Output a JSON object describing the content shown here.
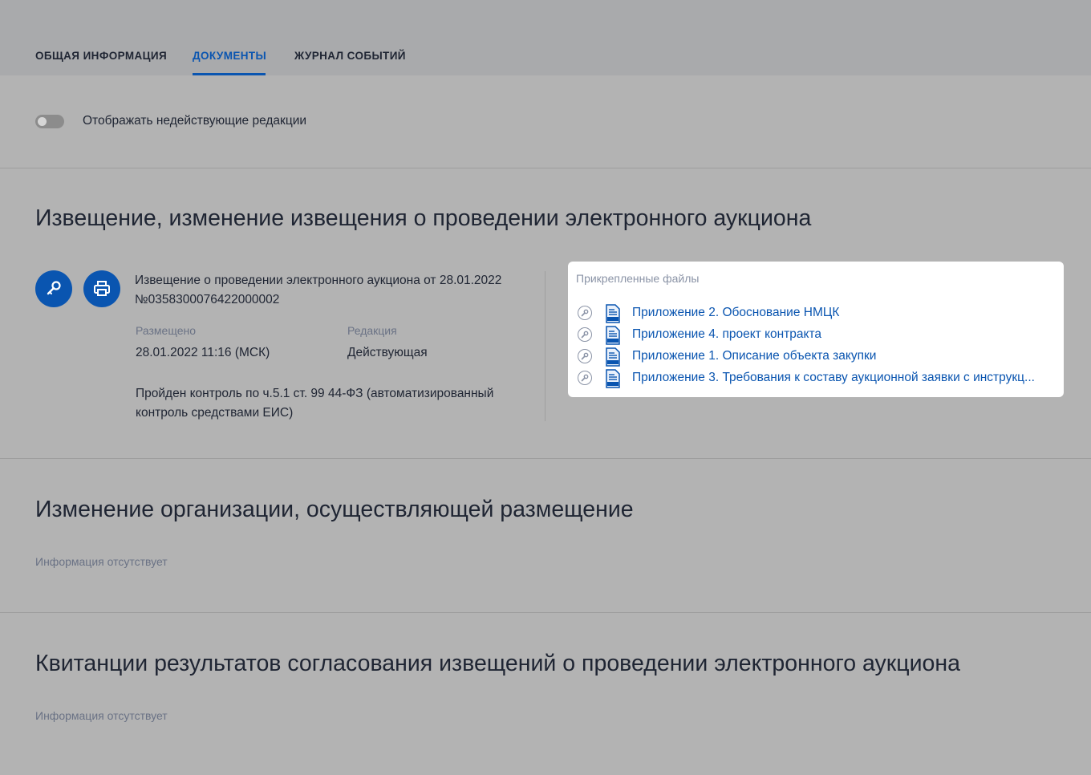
{
  "tabs": [
    {
      "label": "ОБЩАЯ ИНФОРМАЦИЯ",
      "active": false
    },
    {
      "label": "ДОКУМЕНТЫ",
      "active": true
    },
    {
      "label": "ЖУРНАЛ СОБЫТИЙ",
      "active": false
    }
  ],
  "toggle": {
    "label": "Отображать недействующие редакции",
    "checked": false
  },
  "sections": {
    "notice": {
      "title": "Извещение, изменение извещения о проведении электронного аукциона",
      "document_title": "Извещение о проведении электронного аукциона от 28.01.2022 №0358300076422000002",
      "placed_label": "Размещено",
      "placed_value": "28.01.2022 11:16 (МСК)",
      "edition_label": "Редакция",
      "edition_value": "Действующая",
      "control_text": "Пройден контроль по ч.5.1 ст. 99 44-ФЗ (автоматизированный контроль средствами ЕИС)",
      "attached_header": "Прикрепленные файлы",
      "files": [
        {
          "name": "Приложение 2. Обоснование НМЦК"
        },
        {
          "name": "Приложение 4. проект контракта"
        },
        {
          "name": "Приложение 1. Описание объекта закупки"
        },
        {
          "name": "Приложение 3. Требования к составу аукционной заявки с инструкц..."
        }
      ]
    },
    "org_change": {
      "title": "Изменение организации, осуществляющей размещение",
      "info": "Информация отсутствует"
    },
    "receipts": {
      "title": "Квитанции результатов согласования извещений о проведении электронного аукциона",
      "info": "Информация отсутствует"
    }
  },
  "colors": {
    "accent": "#0a55b0",
    "panel_bg": "#ffffff",
    "overlay_bg": "#b3b3b3"
  }
}
